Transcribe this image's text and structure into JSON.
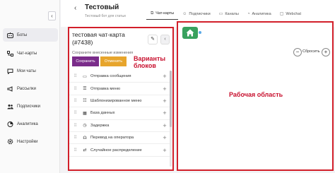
{
  "sidebar": {
    "collapse_icon": "chevron-left-icon",
    "items": [
      {
        "label": "Боты",
        "icon": "bot-icon",
        "active": true
      },
      {
        "label": "Чат-карты",
        "icon": "flow-icon",
        "active": false
      },
      {
        "label": "Мои чаты",
        "icon": "chat-icon",
        "active": false
      },
      {
        "label": "Рассылки",
        "icon": "broadcast-icon",
        "active": false
      },
      {
        "label": "Подписчики",
        "icon": "users-icon",
        "active": false
      },
      {
        "label": "Аналитика",
        "icon": "analytics-icon",
        "active": false
      },
      {
        "label": "Настройки",
        "icon": "gear-icon",
        "active": false
      }
    ]
  },
  "header": {
    "title": "Тестовый",
    "subtitle": "Тестовый бот для статьи",
    "tabs": [
      {
        "label": "Чат-карты",
        "icon": "flow-icon",
        "active": true
      },
      {
        "label": "Подписчики",
        "icon": "users-icon",
        "active": false
      },
      {
        "label": "Каналы",
        "icon": "channels-icon",
        "active": false
      },
      {
        "label": "Аналитика",
        "icon": "analytics-icon",
        "active": false
      },
      {
        "label": "Webchat",
        "icon": "webchat-icon",
        "active": false
      }
    ]
  },
  "panel": {
    "title": "тестовая чат-карта (#7438)",
    "save_hint": "Сохраните внесенные изменения",
    "save_label": "Сохранить",
    "cancel_label": "Отменить",
    "annotation_line1": "Варианты",
    "annotation_line2": "блоков",
    "blocks": [
      {
        "label": "Отправка сообщения",
        "icon": "message-icon"
      },
      {
        "label": "Отправка меню",
        "icon": "menu-icon"
      },
      {
        "label": "Шаблонизированное меню",
        "icon": "template-menu-icon"
      },
      {
        "label": "База данных",
        "icon": "database-icon"
      },
      {
        "label": "Задержка",
        "icon": "clock-icon"
      },
      {
        "label": "Перевод на оператора",
        "icon": "operator-icon"
      },
      {
        "label": "Случайное распределение",
        "icon": "random-icon"
      }
    ]
  },
  "workspace": {
    "label": "Рабочая область",
    "reset_label": "Сбросить"
  },
  "colors": {
    "accent_purple": "#7a2c8a",
    "accent_orange": "#e7a52c",
    "annotation_red": "#c8102e",
    "home_green": "#38a15e"
  }
}
